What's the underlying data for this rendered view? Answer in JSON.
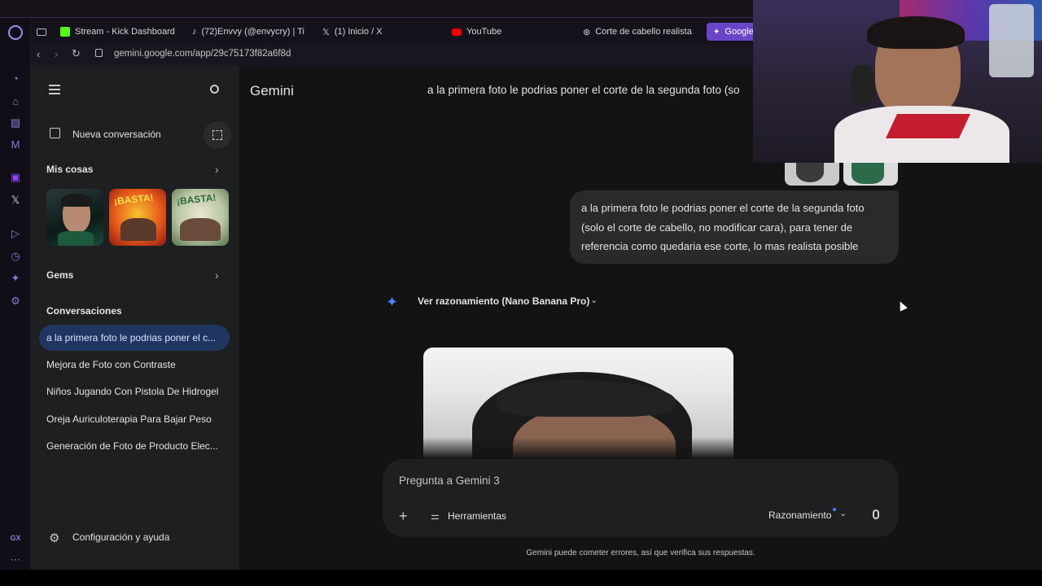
{
  "browser": {
    "tabs": [
      {
        "label": "Stream - Kick Dashboard",
        "icon": "kick-icon",
        "color": "#53fc18"
      },
      {
        "label": "(72)Envvy (@envycry) | Ti",
        "icon": "tiktok-icon",
        "color": "#ffffff"
      },
      {
        "label": "(1) Inicio / X",
        "icon": "x-icon",
        "color": "#ffffff"
      },
      {
        "label": "YouTube",
        "icon": "youtube-icon",
        "color": "#ff0000"
      },
      {
        "label": "Corte de cabello realista",
        "icon": "chatgpt-icon",
        "color": "#ffffff"
      },
      {
        "label": "Google",
        "icon": "gemini-icon",
        "color": "#6b45c9"
      }
    ],
    "url": "gemini.google.com/app/29c75173f82a6f8d"
  },
  "sidebar": {
    "new_chat": "Nueva conversación",
    "my_stuff": "Mis cosas",
    "gems": "Gems",
    "conversations_heading": "Conversaciones",
    "conversations": [
      "a la primera foto le podrias poner el c...",
      "Mejora de Foto con Contraste",
      "Niños Jugando Con Pistola De Hidrogel",
      "Oreja Auriculoterapia Para Bajar Peso",
      "Generación de Foto de Producto Elec..."
    ],
    "settings": "Configuración y ayuda",
    "thumb_text": [
      "¡BASTA!",
      "¡BASTA!"
    ]
  },
  "header": {
    "app_name": "Gemini",
    "chat_title": "a la primera foto le podrias poner el corte de la segunda foto (so"
  },
  "chat": {
    "user_message": "a la primera foto le podrias poner el corte de la segunda foto (solo el corte de cabello, no modificar cara), para tener de referencia como quedaria ese corte, lo mas realista posible",
    "reasoning_label": "Ver razonamiento (Nano Banana Pro)"
  },
  "composer": {
    "placeholder": "Pregunta a Gemini 3",
    "tools": "Herramientas",
    "mode": "Razonamiento"
  },
  "footer": {
    "disclaimer": "Gemini puede cometer errores, así que verifica sus respuestas."
  },
  "rail": {
    "gx_label": "GX"
  },
  "colors": {
    "accent": "#1f3760",
    "opera_purple": "#8a7ad6",
    "gemini_blue": "#4285f4"
  }
}
